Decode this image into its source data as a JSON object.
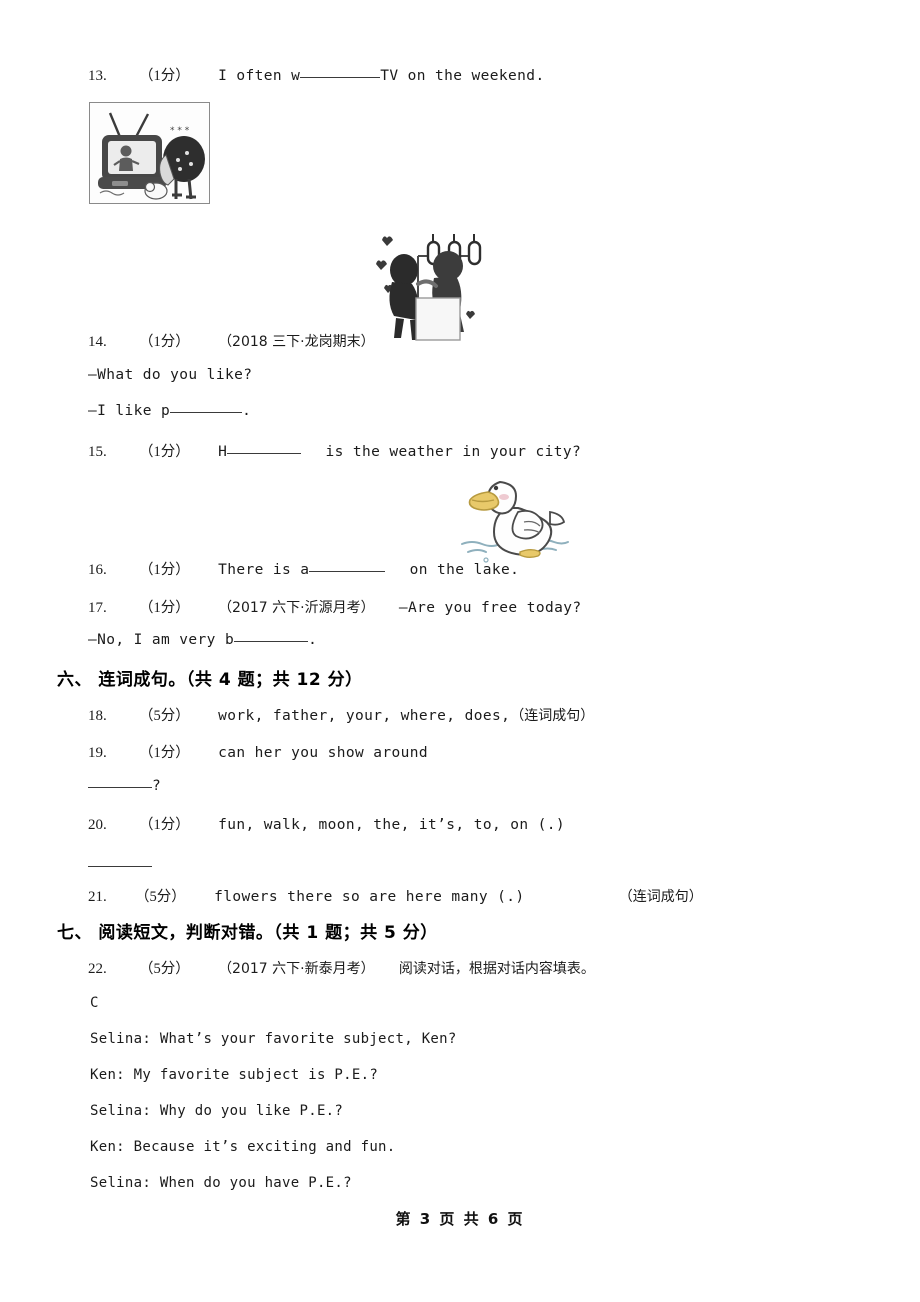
{
  "document": {
    "page_label": "第 3 页 共 6 页",
    "page_current": "3",
    "page_total": "6"
  },
  "questions": [
    {
      "id": "q13",
      "number": "13.",
      "score": "（1分）",
      "text_before": "I often w",
      "text_after": "TV on the weekend.",
      "image": "tv-watching-illustration"
    },
    {
      "id": "q14",
      "number": "14.",
      "score": "（1分）",
      "source": "（2018 三下·龙岗期末）",
      "line1": "—What do you like?",
      "line2_before": "—I like p",
      "line2_after": ".",
      "image": "dancing-couple-illustration"
    },
    {
      "id": "q15",
      "number": "15.",
      "score": "（1分）",
      "text_before": "H",
      "text_after": "is the weather in your city?"
    },
    {
      "id": "q16",
      "number": "16.",
      "score": "（1分）",
      "text_before": "There is a",
      "text_after": "on the lake.",
      "image": "duck-illustration"
    },
    {
      "id": "q17",
      "number": "17.",
      "score": "（1分）",
      "source": "（2017 六下·沂源月考）",
      "line1": "—Are you free today?",
      "line2_before": "—No, I am very b",
      "line2_after": "."
    },
    {
      "id": "q18",
      "number": "18.",
      "score": "（5分）",
      "text": "work, father, your, where, does,",
      "tag": "（连词成句）"
    },
    {
      "id": "q19",
      "number": "19.",
      "score": "（1分）",
      "text": "can    her    you    show    around",
      "answer_suffix": "?"
    },
    {
      "id": "q20",
      "number": "20.",
      "score": "（1分）",
      "text": "fun, walk, moon, the, it’s, to, on (.)"
    },
    {
      "id": "q21",
      "number": "21.",
      "score": "（5分）",
      "text": "flowers    there     so      are      here        many (.)",
      "tag": "（连词成句）"
    },
    {
      "id": "q22",
      "number": "22.",
      "score": "（5分）",
      "source": "（2017 六下·新泰月考）",
      "instruction": "阅读对话，根据对话内容填表。"
    }
  ],
  "sections": [
    {
      "id": "section-6",
      "label": "六、  连词成句。（共 4 题；共 12 分）"
    },
    {
      "id": "section-7",
      "label": "七、  阅读短文，判断对错。（共 1 题；共 5 分）"
    }
  ],
  "reading": {
    "passage_letter": "C",
    "lines": [
      "Selina: What’s your favorite subject, Ken?",
      "Ken: My favorite subject is P.E.?",
      "Selina: Why do you like P.E.?",
      "Ken: Because it’s exciting and fun.",
      "Selina: When do you have P.E.?"
    ]
  },
  "colors": {
    "text": "#1a1a1a",
    "rule": "#3a3a3a",
    "image_border": "#8a8a8a",
    "duck_beak": "#e8c96a",
    "duck_outline": "#4a4a4a",
    "water": "#7fa8b8"
  }
}
